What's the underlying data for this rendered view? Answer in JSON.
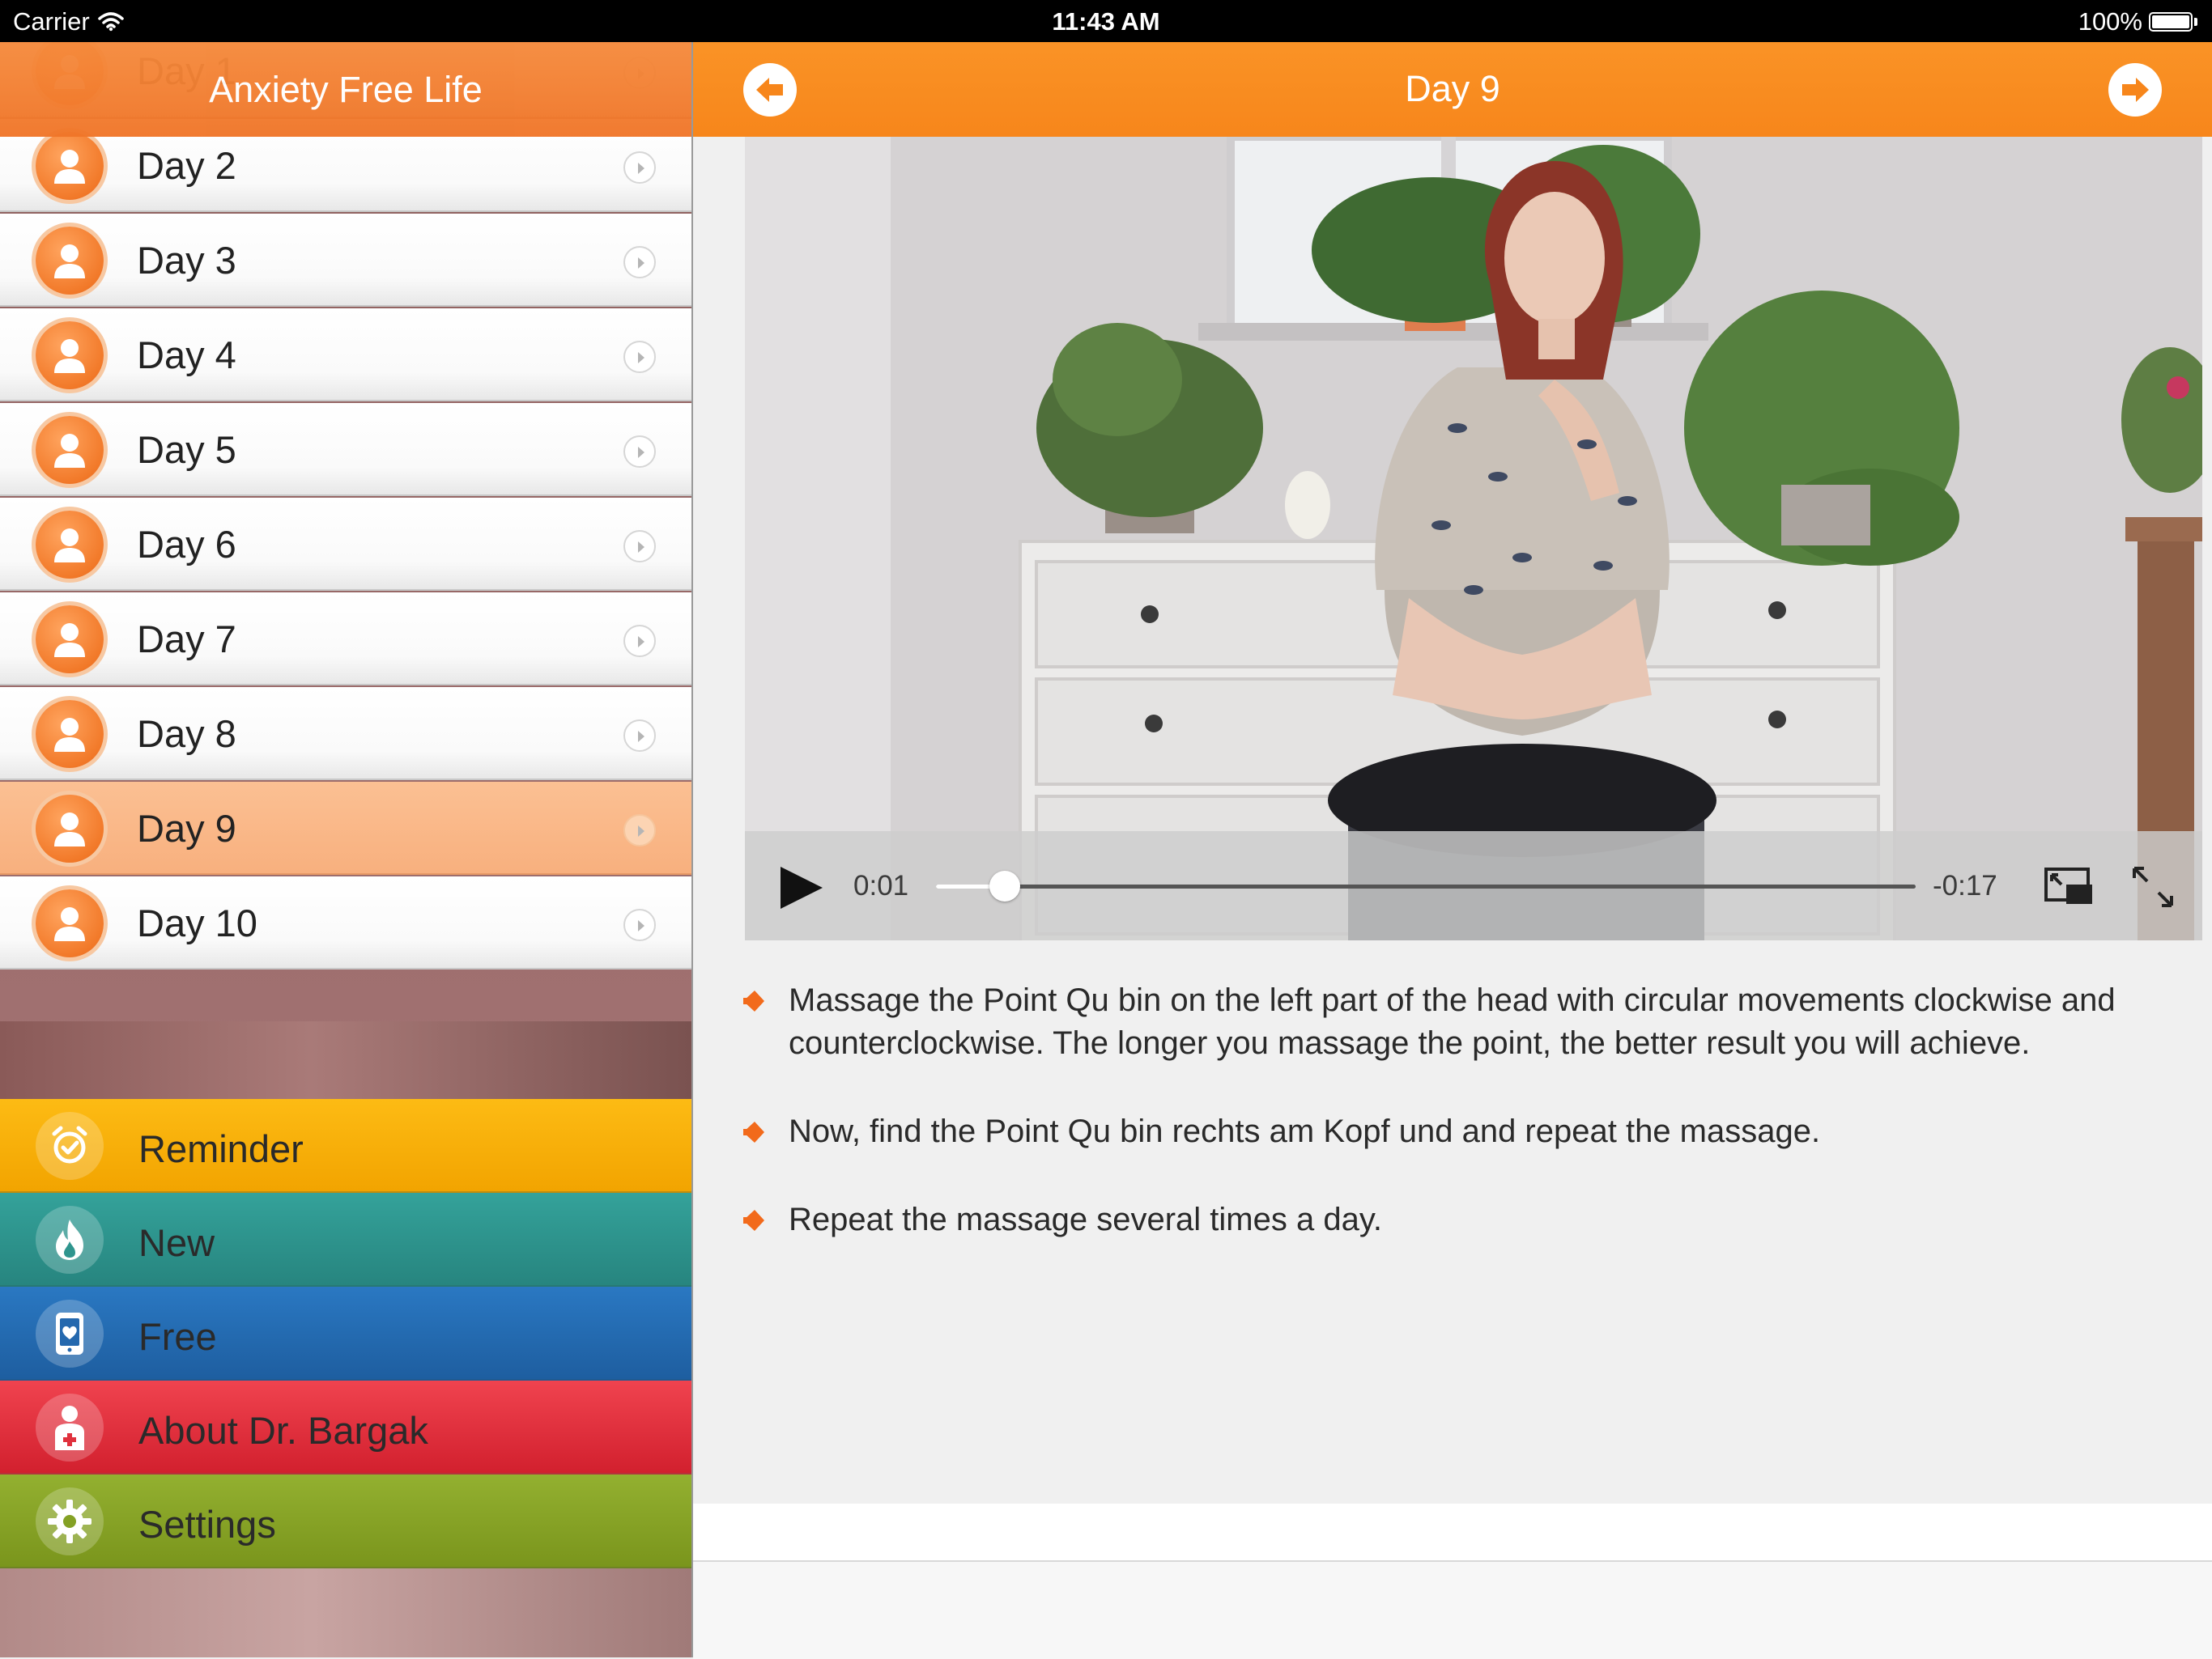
{
  "status_bar": {
    "carrier": "Carrier",
    "time": "11:43 AM",
    "battery": "100%"
  },
  "sidebar": {
    "title": "Anxiety Free Life",
    "days": [
      {
        "label": "Day 1"
      },
      {
        "label": "Day 2"
      },
      {
        "label": "Day 3"
      },
      {
        "label": "Day 4"
      },
      {
        "label": "Day 5"
      },
      {
        "label": "Day 6"
      },
      {
        "label": "Day 7"
      },
      {
        "label": "Day 8"
      },
      {
        "label": "Day 9",
        "selected": true
      },
      {
        "label": "Day 10"
      }
    ],
    "menu": [
      {
        "label": "Reminder",
        "icon": "alarm-clock-icon",
        "color": "#fdbb14"
      },
      {
        "label": "New",
        "icon": "flame-icon",
        "color": "#34a29a"
      },
      {
        "label": "Free",
        "icon": "heart-phone-icon",
        "color": "#2a78c2"
      },
      {
        "label": "About Dr. Bargak",
        "icon": "doctor-icon",
        "color": "#f0434f"
      },
      {
        "label": "Settings",
        "icon": "gear-icon",
        "color": "#93b030"
      }
    ]
  },
  "detail": {
    "title": "Day 9",
    "accent_color": "#f7861b",
    "video": {
      "elapsed": "0:01",
      "remaining": "-0:17",
      "progress": 0.07
    },
    "steps": [
      "Massage the Point Qu bin on the left part of the head with circular movements clockwise and counterclockwise. The longer you massage the point, the better result you will achieve.",
      "Now, find the Point Qu bin rechts am Kopf und and repeat the massage.",
      "Repeat the massage several times a day."
    ]
  }
}
